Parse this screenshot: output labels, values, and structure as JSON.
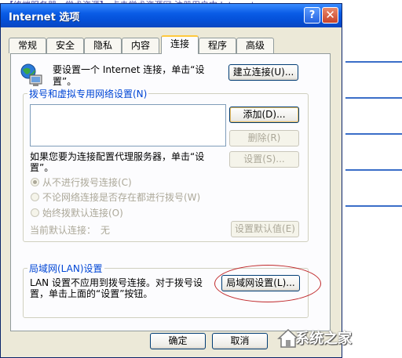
{
  "background": {
    "top_text": "【终端服务器，学术资源】 点击学术资源网 注册用户中 Internet"
  },
  "window": {
    "title": "Internet 选项",
    "help_glyph": "?",
    "close_glyph": "✕"
  },
  "tabs": [
    {
      "label": "常规"
    },
    {
      "label": "安全"
    },
    {
      "label": "隐私"
    },
    {
      "label": "内容"
    },
    {
      "label": "连接"
    },
    {
      "label": "程序"
    },
    {
      "label": "高级"
    }
  ],
  "setup": {
    "text_line1": "要设置一个 Internet 连接，单击“设",
    "text_line2": "置”。",
    "button": "建立连接(U)..."
  },
  "dialup": {
    "group_label": "拨号和虚拟专用网络设置(N)",
    "add_button": "添加(D)...",
    "remove_button": "删除(R)",
    "settings_button": "设置(S)...",
    "proxy_text_line1": "如果您要为连接配置代理服务器，单击“设",
    "proxy_text_line2": "置”。",
    "radio_never": "从不进行拨号连接(C)",
    "radio_no_network": "不论网络连接是否存在都进行拨号(W)",
    "radio_always": "始终拨默认连接(O)",
    "current_default_label": "当前默认连接：",
    "current_default_value": "无",
    "set_default_button": "设置默认值(E)"
  },
  "lan": {
    "group_label": "局域网(LAN)设置",
    "text_line1": "LAN 设置不应用到拨号连接。对于拨号设",
    "text_line2": "置，单击上面的“设置”按钮。",
    "button": "局域网设置(L)..."
  },
  "footer": {
    "ok_button": "确定",
    "cancel_button": "取消"
  },
  "watermark": {
    "text": "系统之家"
  },
  "colors": {
    "title_bar": "#0450d8",
    "group_label": "#0046d5",
    "annotation_ellipse": "#c0282a"
  }
}
